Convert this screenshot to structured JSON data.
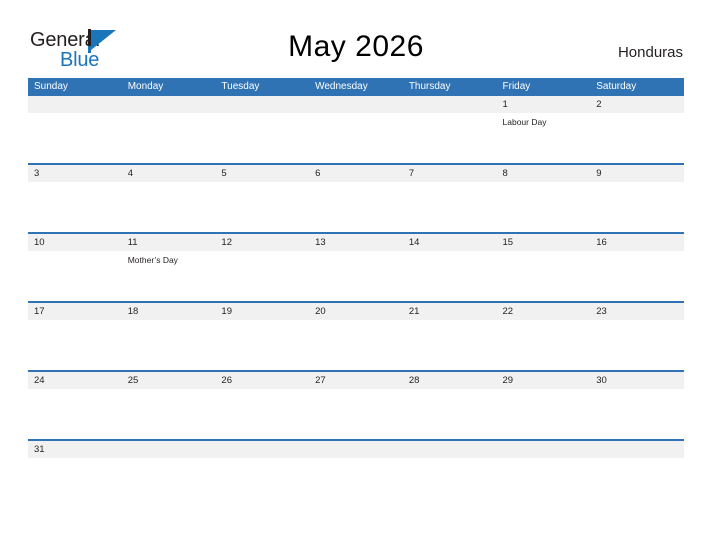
{
  "logo": {
    "word_one": "General",
    "word_two": "Blue",
    "mark": "blue-flag-triangle"
  },
  "header": {
    "title": "May 2026",
    "country": "Honduras"
  },
  "colors": {
    "header_blue": "#2f73b5",
    "logo_blue": "#1b75bb",
    "date_band_gray": "#f1f1f1",
    "text_dark": "#231f20",
    "page_background": "#ffffff"
  },
  "calendar": {
    "weekdays": [
      "Sunday",
      "Monday",
      "Tuesday",
      "Wednesday",
      "Thursday",
      "Friday",
      "Saturday"
    ],
    "weeks": [
      {
        "days": [
          {
            "date": "",
            "events": []
          },
          {
            "date": "",
            "events": []
          },
          {
            "date": "",
            "events": []
          },
          {
            "date": "",
            "events": []
          },
          {
            "date": "",
            "events": []
          },
          {
            "date": "1",
            "events": [
              "Labour Day"
            ]
          },
          {
            "date": "2",
            "events": []
          }
        ]
      },
      {
        "days": [
          {
            "date": "3",
            "events": []
          },
          {
            "date": "4",
            "events": []
          },
          {
            "date": "5",
            "events": []
          },
          {
            "date": "6",
            "events": []
          },
          {
            "date": "7",
            "events": []
          },
          {
            "date": "8",
            "events": []
          },
          {
            "date": "9",
            "events": []
          }
        ]
      },
      {
        "days": [
          {
            "date": "10",
            "events": []
          },
          {
            "date": "11",
            "events": [
              "Mother’s Day"
            ]
          },
          {
            "date": "12",
            "events": []
          },
          {
            "date": "13",
            "events": []
          },
          {
            "date": "14",
            "events": []
          },
          {
            "date": "15",
            "events": []
          },
          {
            "date": "16",
            "events": []
          }
        ]
      },
      {
        "days": [
          {
            "date": "17",
            "events": []
          },
          {
            "date": "18",
            "events": []
          },
          {
            "date": "19",
            "events": []
          },
          {
            "date": "20",
            "events": []
          },
          {
            "date": "21",
            "events": []
          },
          {
            "date": "22",
            "events": []
          },
          {
            "date": "23",
            "events": []
          }
        ]
      },
      {
        "days": [
          {
            "date": "24",
            "events": []
          },
          {
            "date": "25",
            "events": []
          },
          {
            "date": "26",
            "events": []
          },
          {
            "date": "27",
            "events": []
          },
          {
            "date": "28",
            "events": []
          },
          {
            "date": "29",
            "events": []
          },
          {
            "date": "30",
            "events": []
          }
        ]
      },
      {
        "days": [
          {
            "date": "31",
            "events": []
          },
          {
            "date": "",
            "events": []
          },
          {
            "date": "",
            "events": []
          },
          {
            "date": "",
            "events": []
          },
          {
            "date": "",
            "events": []
          },
          {
            "date": "",
            "events": []
          },
          {
            "date": "",
            "events": []
          }
        ]
      }
    ]
  }
}
